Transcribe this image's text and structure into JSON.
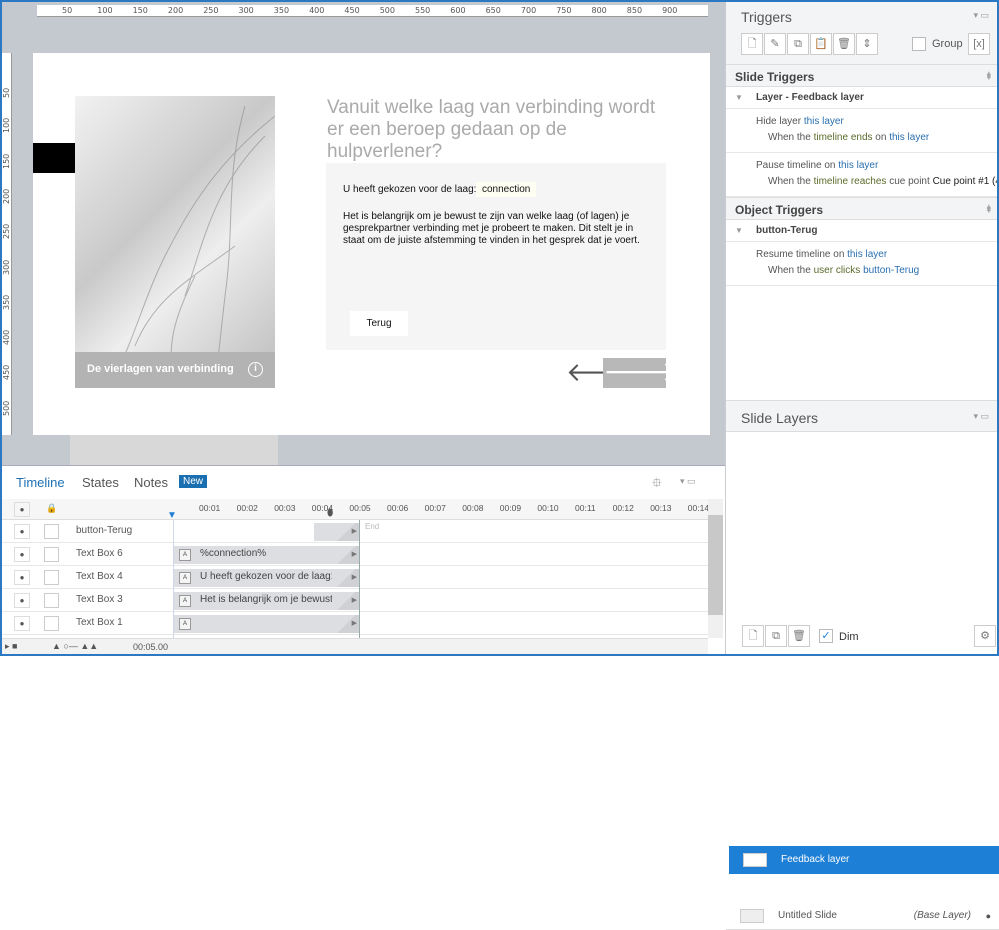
{
  "ruler": {
    "top": [
      "50",
      "100",
      "150",
      "200",
      "250",
      "300",
      "350",
      "400",
      "450",
      "500",
      "550",
      "600",
      "650",
      "700",
      "750",
      "800",
      "850",
      "900"
    ],
    "left": [
      "50",
      "100",
      "150",
      "200",
      "250",
      "300",
      "350",
      "400",
      "450",
      "500"
    ]
  },
  "slide": {
    "question": "Vanuit welke laag van verbinding wordt er een beroep gedaan op de hulpverlener?",
    "caption": "De vierlagen van verbinding",
    "info_glyph": "i",
    "chosen_label": "U heeft gekozen voor de laag:",
    "connection": "connection",
    "body": "Het is belangrijk om je bewust te zijn van welke laag (of lagen) je gesprekpartner verbinding met je probeert te maken. Dit stelt je in staat om de juiste afstemming te vinden in het gesprek dat je voert.",
    "terug": "Terug",
    "prev_glyph": "🡐",
    "next_glyph": "🡒"
  },
  "triggers": {
    "title": "Triggers",
    "group_label": "Group",
    "slide_triggers": "Slide Triggers",
    "slide_group": "Layer - Feedback layer",
    "t1": {
      "action": "Hide layer",
      "target": "this layer",
      "when": "When the",
      "ev": "timeline ends",
      "on": "on",
      "on_target": "this layer"
    },
    "t2": {
      "action": "Pause timeline on",
      "target": "this layer",
      "when": "When the",
      "ev": "timeline reaches",
      "cue": "cue point",
      "cue_name": "Cue point #1 (4...."
    },
    "object_triggers": "Object Triggers",
    "object_group": "button-Terug",
    "t3": {
      "action": "Resume timeline on",
      "target": "this layer",
      "when": "When the",
      "ev": "user clicks",
      "obj": "button-Terug"
    }
  },
  "layers": {
    "title": "Slide Layers",
    "items": [
      {
        "name": "Feedback layer",
        "selected": true
      },
      {
        "name": "Untitled Slide",
        "tag": "(Base Layer)"
      }
    ],
    "dim_label": "Dim",
    "dim_checked": true
  },
  "timeline": {
    "tabs": [
      "Timeline",
      "States",
      "Notes"
    ],
    "new_badge": "New",
    "times": [
      "00:01",
      "00:02",
      "00:03",
      "00:04",
      "00:05",
      "00:06",
      "00:07",
      "00:08",
      "00:09",
      "00:10",
      "00:11",
      "00:12",
      "00:13",
      "00:14"
    ],
    "end_label": "End",
    "rows": [
      {
        "name": "button-Terug",
        "bar": ""
      },
      {
        "name": "Text Box 6",
        "bar": "%connection%"
      },
      {
        "name": "Text Box 4",
        "bar": "U heeft gekozen voor de laag:"
      },
      {
        "name": "Text Box 3",
        "bar": "Het is belangrijk om je bewust..."
      },
      {
        "name": "Text Box 1",
        "bar": ""
      }
    ],
    "duration": "00:05.00"
  },
  "colors": {
    "accent": "#2b79c2",
    "selected": "#1e7fd6"
  }
}
